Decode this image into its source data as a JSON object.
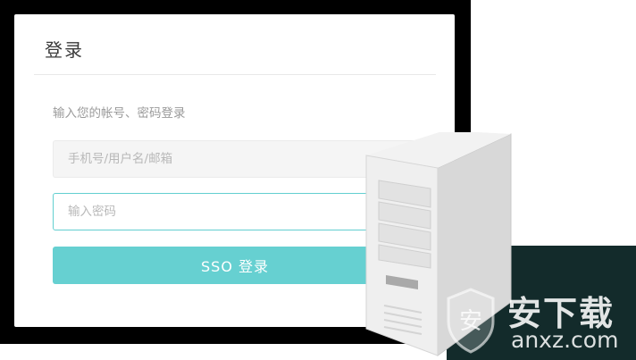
{
  "login": {
    "title": "登录",
    "hint": "输入您的帐号、密码登录",
    "username_placeholder": "手机号/用户名/邮箱",
    "password_placeholder": "输入密码",
    "sso_button_label": "SSO 登录"
  },
  "watermark": {
    "logo_text": "安下载",
    "url": "anxz.com"
  },
  "colors": {
    "accent": "#66d0d1",
    "focus_border": "#62cfd0",
    "frame": "#000000",
    "corner": "#132b2b"
  },
  "icons": [
    "server-tower-icon",
    "shield-logo-icon"
  ]
}
